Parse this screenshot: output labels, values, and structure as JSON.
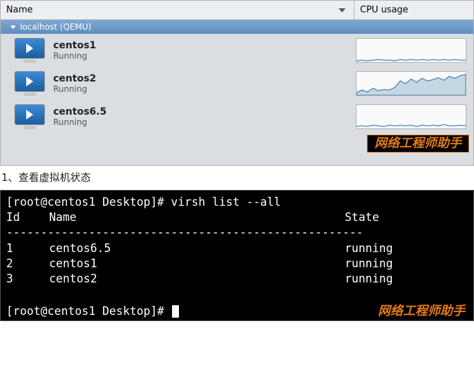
{
  "vm_manager": {
    "columns": {
      "name": "Name",
      "cpu": "CPU usage"
    },
    "host": "localhost (QEMU)",
    "vms": [
      {
        "name": "centos1",
        "status": "Running"
      },
      {
        "name": "centos2",
        "status": "Running"
      },
      {
        "name": "centos6.5",
        "status": "Running"
      }
    ],
    "watermark": "网络工程师助手"
  },
  "caption": "1、查看虚拟机状态",
  "terminal": {
    "prompt": "[root@centos1 Desktop]# ",
    "command": "virsh list --all",
    "header": {
      "id": "Id",
      "name": "Name",
      "state": "State"
    },
    "rows": [
      {
        "id": "1",
        "name": "centos6.5",
        "state": "running"
      },
      {
        "id": "2",
        "name": "centos1",
        "state": "running"
      },
      {
        "id": "3",
        "name": "centos2",
        "state": "running"
      }
    ],
    "divider": "----------------------------------------------------",
    "watermark": "网络工程师助手"
  },
  "chart_data": [
    {
      "type": "line",
      "title": "centos1 CPU usage",
      "ylim": [
        0,
        100
      ],
      "values": [
        2,
        1,
        2,
        1,
        3,
        2,
        2,
        1,
        4,
        2,
        3,
        2,
        3,
        2,
        3,
        2,
        4,
        2,
        3,
        2
      ]
    },
    {
      "type": "area",
      "title": "centos2 CPU usage",
      "ylim": [
        0,
        100
      ],
      "values": [
        10,
        18,
        12,
        25,
        15,
        22,
        18,
        30,
        55,
        45,
        62,
        50,
        65,
        55,
        60,
        68,
        58,
        72,
        65,
        80
      ]
    },
    {
      "type": "line",
      "title": "centos6.5 CPU usage",
      "ylim": [
        0,
        100
      ],
      "values": [
        3,
        5,
        4,
        6,
        5,
        4,
        6,
        5,
        7,
        5,
        6,
        4,
        7,
        5,
        6,
        5,
        7,
        6,
        5,
        6
      ]
    }
  ]
}
